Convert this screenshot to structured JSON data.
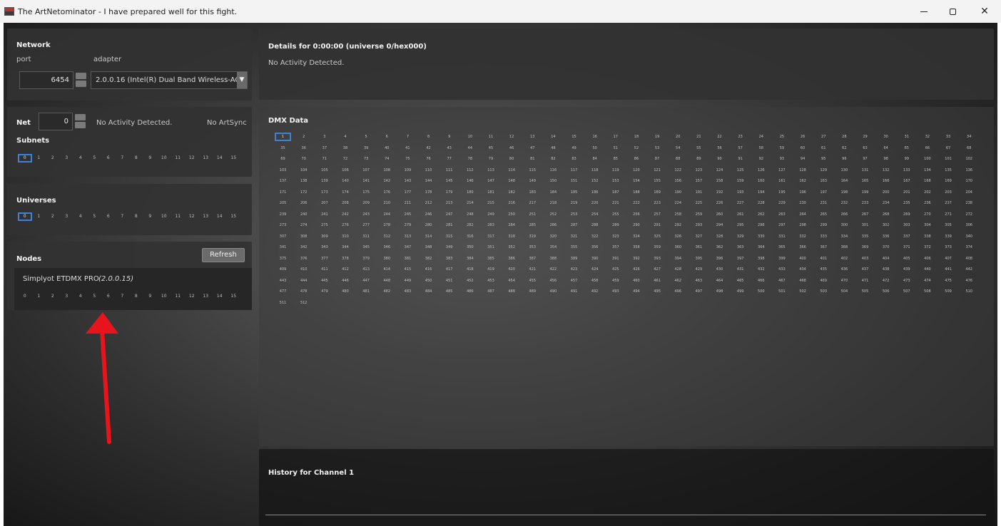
{
  "window": {
    "title": "The ArtNetominator - I have prepared well for this fight.",
    "icon": "app-icon"
  },
  "network": {
    "heading": "Network",
    "port_label": "port",
    "port_value": "6454",
    "adapter_label": "adapter",
    "adapter_value": "2.0.0.16 (Intel(R) Dual Band Wireless-AC"
  },
  "net": {
    "label": "Net",
    "value": "0",
    "status": "No Activity Detected.",
    "sync": "No ArtSync"
  },
  "subnets": {
    "label": "Subnets",
    "items": [
      "0",
      "1",
      "2",
      "3",
      "4",
      "5",
      "6",
      "7",
      "8",
      "9",
      "10",
      "11",
      "12",
      "13",
      "14",
      "15"
    ],
    "selected": "0"
  },
  "universes": {
    "label": "Universes",
    "items": [
      "0",
      "1",
      "2",
      "3",
      "4",
      "5",
      "6",
      "7",
      "8",
      "9",
      "10",
      "11",
      "12",
      "13",
      "14",
      "15"
    ],
    "selected": "0"
  },
  "nodes": {
    "label": "Nodes",
    "refresh_label": "Refresh",
    "node_name": "Simplyot ETDMX PRO",
    "node_version": "(2.0.0.15)",
    "ports": [
      "0",
      "1",
      "2",
      "3",
      "4",
      "5",
      "6",
      "7",
      "8",
      "9",
      "10",
      "11",
      "12",
      "13",
      "14",
      "15"
    ]
  },
  "details": {
    "title": "Details for 0:00:00 (universe 0/hex000)",
    "status": "No Activity Detected."
  },
  "dmx": {
    "title": "DMX Data",
    "channel_count": 512,
    "selected_channel": 1
  },
  "history": {
    "title": "History for Channel 1"
  },
  "colors": {
    "selection": "#3c82d6",
    "arrow": "#e8141b"
  }
}
